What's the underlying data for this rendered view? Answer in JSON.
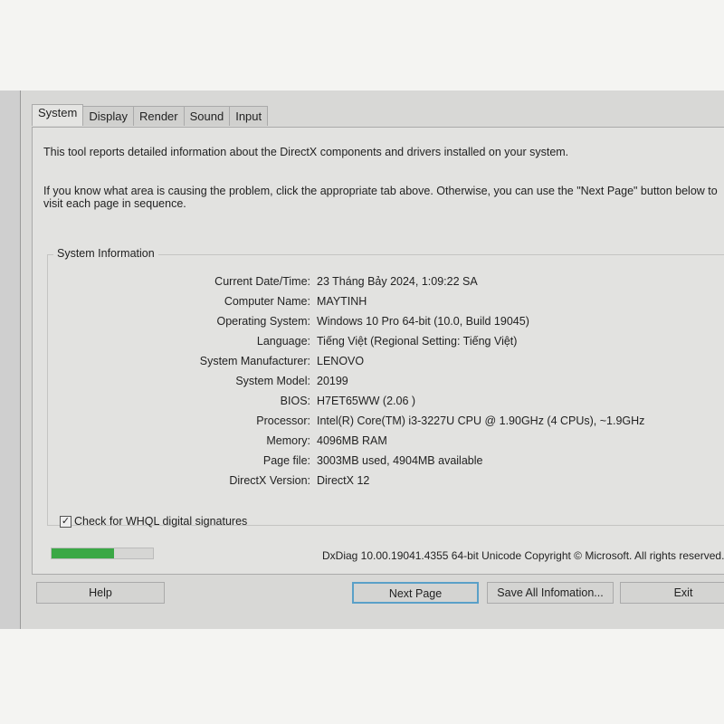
{
  "tabs": [
    "System",
    "Display",
    "Render",
    "Sound",
    "Input"
  ],
  "intro1": "This tool reports detailed information about the DirectX components and drivers installed on your system.",
  "intro2": "If you know what area is causing the problem, click the appropriate tab above.  Otherwise, you can use the \"Next Page\" button below to",
  "intro3": "visit each page in sequence.",
  "group_title": "System Information",
  "info": [
    {
      "label": "Current Date/Time:",
      "value": "23 Tháng Bảy 2024, 1:09:22 SA"
    },
    {
      "label": "Computer Name:",
      "value": "MAYTINH"
    },
    {
      "label": "Operating System:",
      "value": "Windows 10 Pro 64-bit (10.0, Build 19045)"
    },
    {
      "label": "Language:",
      "value": "Tiếng Việt (Regional Setting: Tiếng Việt)"
    },
    {
      "label": "System Manufacturer:",
      "value": "LENOVO"
    },
    {
      "label": "System Model:",
      "value": "20199"
    },
    {
      "label": "BIOS:",
      "value": "H7ET65WW (2.06 )"
    },
    {
      "label": "Processor:",
      "value": "Intel(R) Core(TM) i3-3227U CPU @ 1.90GHz (4 CPUs), ~1.9GHz"
    },
    {
      "label": "Memory:",
      "value": "4096MB RAM"
    },
    {
      "label": "Page file:",
      "value": "3003MB used, 4904MB available"
    },
    {
      "label": "DirectX Version:",
      "value": "DirectX 12"
    }
  ],
  "whql_label": "Check for WHQL digital signatures",
  "whql_checked": true,
  "progress_percent": 62,
  "progress_color": "#3aa845",
  "version": "DxDiag 10.00.19041.4355 64-bit Unicode  Copyright © Microsoft. All rights reserved.",
  "buttons": {
    "help": "Help",
    "next": "Next Page",
    "save": "Save All Infomation...",
    "exit": "Exit"
  }
}
